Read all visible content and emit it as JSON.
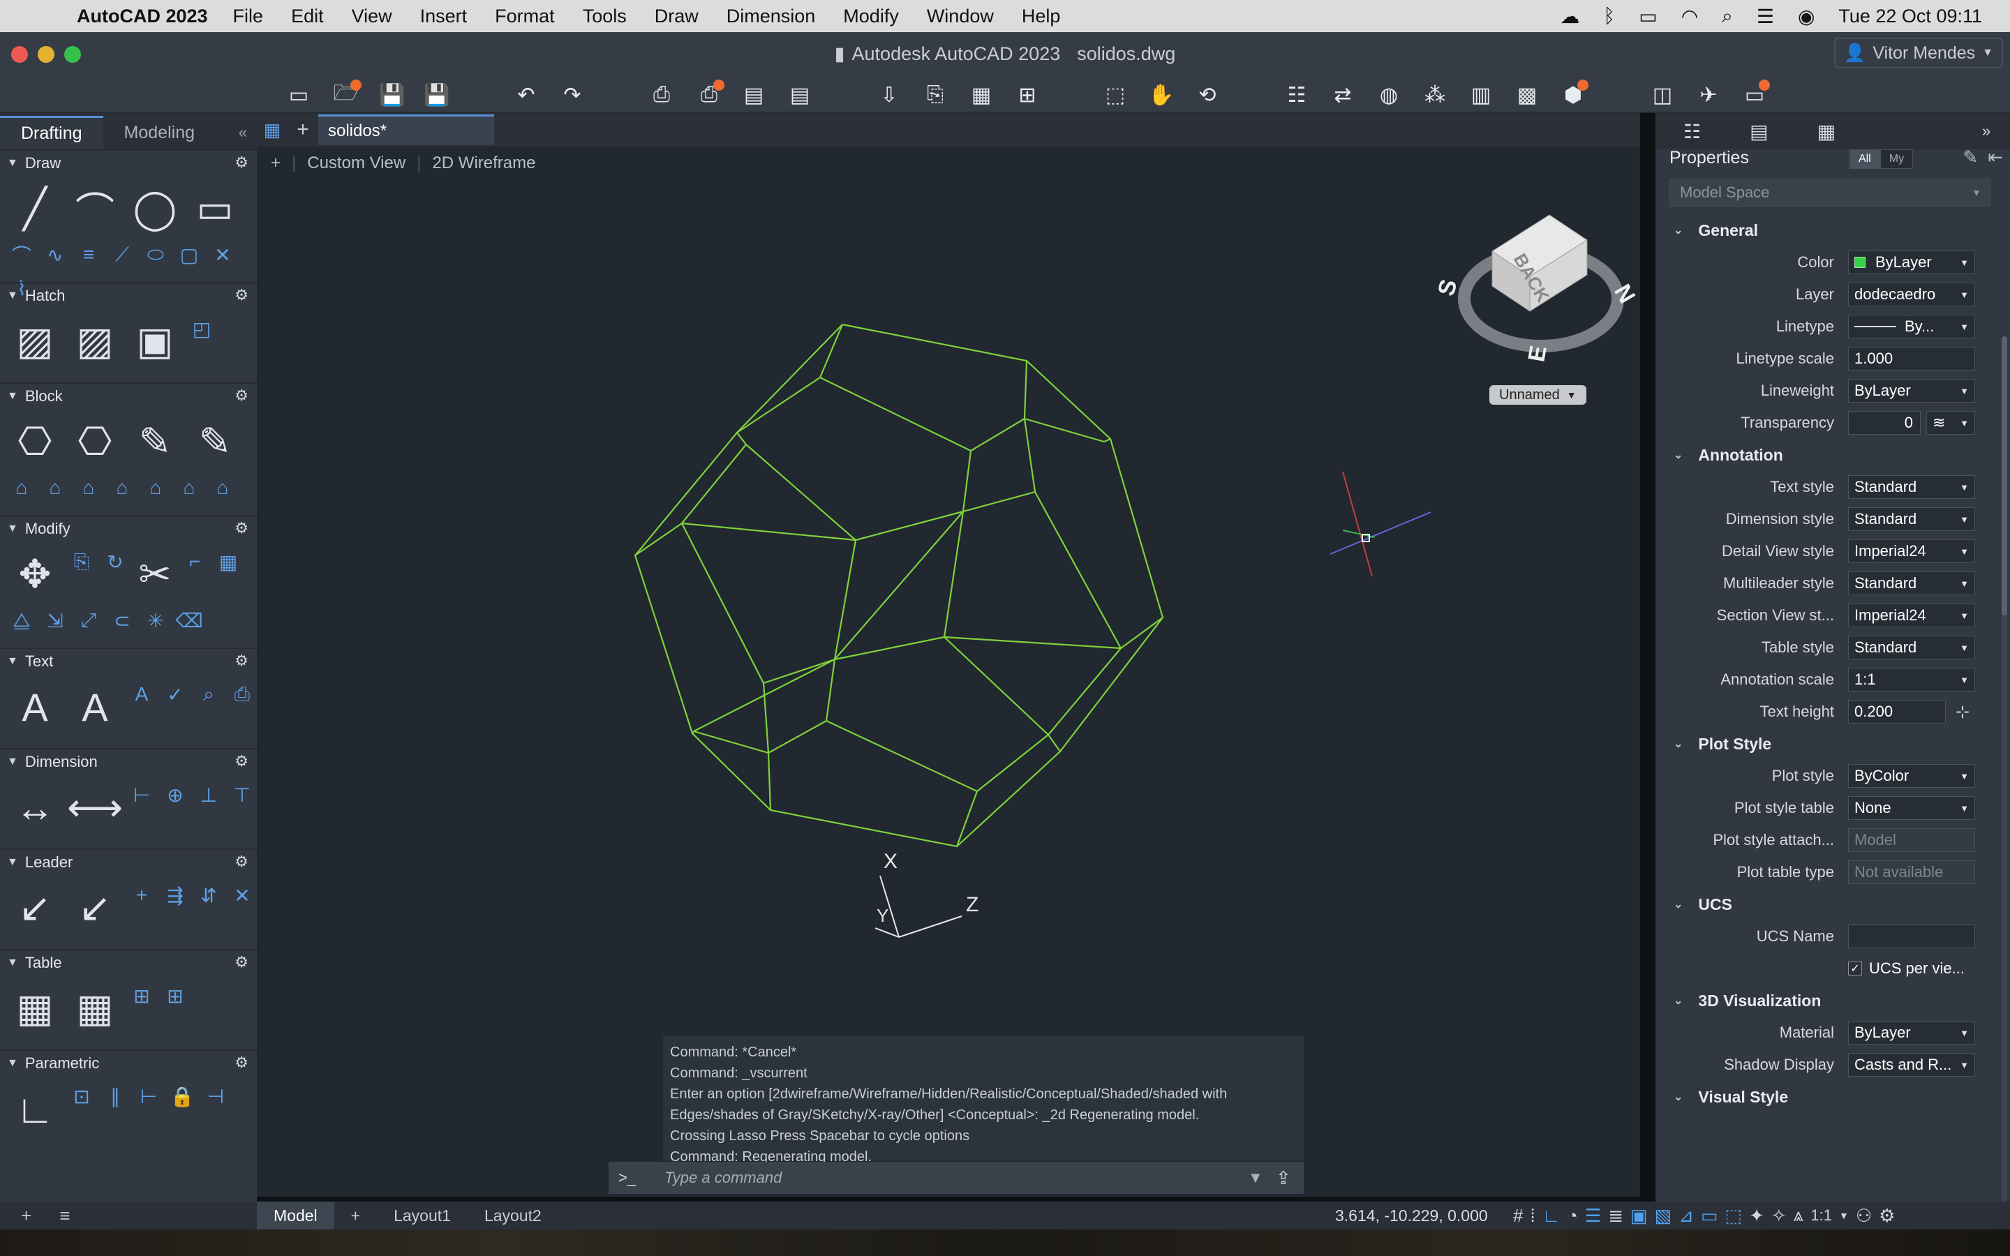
{
  "menubar": {
    "app": "AutoCAD 2023",
    "items": [
      "File",
      "Edit",
      "View",
      "Insert",
      "Format",
      "Tools",
      "Draw",
      "Dimension",
      "Modify",
      "Window",
      "Help"
    ],
    "clock": "Tue 22 Oct  09:11"
  },
  "titlebar": {
    "title": "Autodesk AutoCAD 2023",
    "file": "solidos.dwg",
    "user": "Vitor Mendes"
  },
  "left_panel": {
    "tabs": [
      "Drafting",
      "Modeling"
    ],
    "sections": [
      "Draw",
      "Hatch",
      "Block",
      "Modify",
      "Text",
      "Dimension",
      "Leader",
      "Table",
      "Parametric"
    ]
  },
  "doc_tab": {
    "name": "solidos*"
  },
  "viewport": {
    "view": "Custom View",
    "style": "2D Wireframe",
    "cube_label": "BACK",
    "compass": {
      "n": "N",
      "s": "S",
      "e": "E"
    },
    "ucs_name": "Unnamed",
    "axis_x": "X",
    "axis_y": "Y",
    "axis_z": "Z"
  },
  "command": {
    "history": [
      "Command: *Cancel*",
      "Command: _vscurrent",
      "Enter an option [2dwireframe/Wireframe/Hidden/Realistic/Conceptual/Shaded/shaded with",
      "Edges/shades of Gray/SKetchy/X-ray/Other] <Conceptual>: _2d Regenerating model.",
      "Crossing Lasso  Press Spacebar to cycle options",
      "Command:  Regenerating model."
    ],
    "prompt": ">_",
    "placeholder": "Type a command"
  },
  "layout_tabs": [
    "Model",
    "Layout1",
    "Layout2"
  ],
  "status": {
    "coords": "3.614,  -10.229, 0.000",
    "scale": "1:1"
  },
  "properties": {
    "title": "Properties",
    "filter_all": "All",
    "filter_my": "My",
    "scope": "Model Space",
    "general": {
      "title": "General",
      "rows": [
        {
          "label": "Color",
          "value": "ByLayer"
        },
        {
          "label": "Layer",
          "value": "dodecaedro"
        },
        {
          "label": "Linetype",
          "value": "By..."
        },
        {
          "label": "Linetype scale",
          "value": "1.000"
        },
        {
          "label": "Lineweight",
          "value": "ByLayer"
        },
        {
          "label": "Transparency",
          "value": "0"
        }
      ]
    },
    "annotation": {
      "title": "Annotation",
      "rows": [
        {
          "label": "Text style",
          "value": "Standard"
        },
        {
          "label": "Dimension style",
          "value": "Standard"
        },
        {
          "label": "Detail View style",
          "value": "Imperial24"
        },
        {
          "label": "Multileader style",
          "value": "Standard"
        },
        {
          "label": "Section View st...",
          "value": "Imperial24"
        },
        {
          "label": "Table style",
          "value": "Standard"
        },
        {
          "label": "Annotation scale",
          "value": "1:1"
        },
        {
          "label": "Text height",
          "value": "0.200"
        }
      ]
    },
    "plot_style": {
      "title": "Plot Style",
      "rows": [
        {
          "label": "Plot style",
          "value": "ByColor"
        },
        {
          "label": "Plot style table",
          "value": "None"
        },
        {
          "label": "Plot style attach...",
          "value": "Model"
        },
        {
          "label": "Plot table type",
          "value": "Not available"
        }
      ]
    },
    "ucs": {
      "title": "UCS",
      "name_label": "UCS Name",
      "name_value": "",
      "per_view": "UCS per vie..."
    },
    "viz": {
      "title": "3D Visualization",
      "rows": [
        {
          "label": "Material",
          "value": "ByLayer"
        },
        {
          "label": "Shadow Display",
          "value": "Casts and R..."
        }
      ]
    },
    "visual_style": {
      "title": "Visual Style"
    }
  },
  "colors": {
    "accent": "#5a93d6",
    "wire": "#7fd13b",
    "swatch": "#38d24a",
    "badge": "#ef6a2f"
  }
}
